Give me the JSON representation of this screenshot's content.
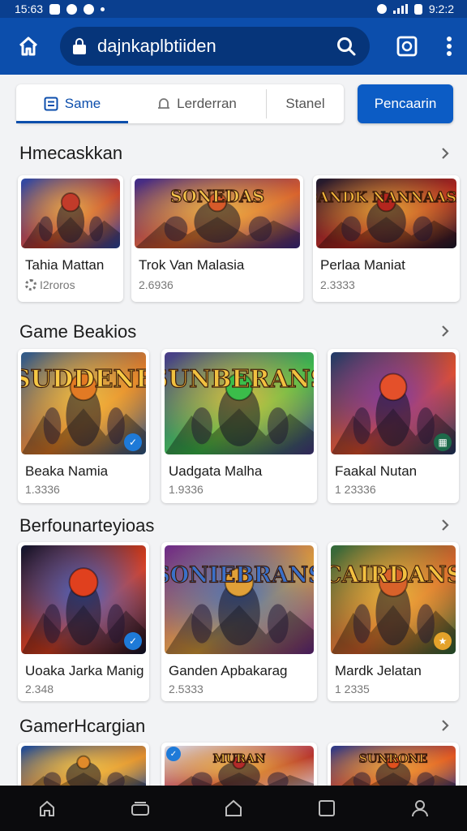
{
  "status_bar": {
    "time_left": "15:63",
    "time_right": "9:2:2"
  },
  "address_bar": {
    "url": "dajnkaplbtiiden"
  },
  "tabs": [
    {
      "label": "Same",
      "icon": "list-icon",
      "active": true
    },
    {
      "label": "Lerderran",
      "icon": "bell-icon",
      "active": false
    },
    {
      "label": "Stanel",
      "icon": "",
      "active": false
    }
  ],
  "primary_button": {
    "label": "Pencaarin"
  },
  "sections": [
    {
      "title": "Hmecaskkan",
      "games": [
        {
          "name": "Tahia Mattan",
          "meta": "I2roros",
          "art_title": "",
          "palette": [
            "#2a4aa8",
            "#c23b2a",
            "#f3b84a"
          ]
        },
        {
          "name": "Trok Van Malasia",
          "meta": "2.6936",
          "art_title": "SONEDAS",
          "palette": [
            "#3d2a8a",
            "#d65a2a",
            "#f2c14a"
          ]
        },
        {
          "name": "Perlaa Maniat",
          "meta": "2.3333",
          "art_title": "DANDK NANNAASA",
          "palette": [
            "#1c1a2e",
            "#b3261e",
            "#f0b43a"
          ]
        }
      ]
    },
    {
      "title": "Game Beakios",
      "games": [
        {
          "name": "Beaka Namia",
          "meta": "1.3336",
          "art_title": "SUDDENE",
          "palette": [
            "#2d5a8c",
            "#e27a24",
            "#f6c845"
          ]
        },
        {
          "name": "Uadgata Malha",
          "meta": "1.9336",
          "art_title": "SUNBERANS",
          "palette": [
            "#4a3a8a",
            "#3bbd4a",
            "#f0c040"
          ]
        },
        {
          "name": "Faakal Nutan",
          "meta": "1 23336",
          "art_title": "",
          "palette": [
            "#1e3a6a",
            "#e4502a",
            "#7a3ab0"
          ]
        }
      ]
    },
    {
      "title": "Berfounarteyioas",
      "games": [
        {
          "name": "Uoaka Jarka Manig",
          "meta": "2.348",
          "art_title": "",
          "palette": [
            "#0e1530",
            "#e0401e",
            "#3a6ad8"
          ]
        },
        {
          "name": "Ganden Apbakarag",
          "meta": "2.5333",
          "art_title": "SONIEBRANS",
          "palette": [
            "#6a2a8a",
            "#e0a038",
            "#3a70c8"
          ]
        },
        {
          "name": "Mardk Jelatan",
          "meta": "1 2335",
          "art_title": "CAIRDANS",
          "palette": [
            "#2f6a3a",
            "#d8622a",
            "#f2c040"
          ]
        }
      ]
    },
    {
      "title": "GamerHcargian",
      "games": [
        {
          "name": "",
          "meta": "",
          "art_title": "",
          "palette": [
            "#1a4a9a",
            "#e08a2a",
            "#f5c84a"
          ]
        },
        {
          "name": "",
          "meta": "",
          "art_title": "MURAN",
          "palette": [
            "#d8dde8",
            "#b32a2a",
            "#f2c040"
          ]
        },
        {
          "name": "",
          "meta": "",
          "art_title": "SUNRONE",
          "palette": [
            "#2a3a8a",
            "#e0501e",
            "#f2b040"
          ]
        }
      ]
    }
  ],
  "bottom_nav": [
    "home-icon",
    "tabs-icon",
    "home-outline-icon",
    "square-icon",
    "profile-icon"
  ],
  "colors": {
    "brand": "#0c4eac",
    "brand_dark": "#06357a",
    "button": "#0c5cc5",
    "background": "#f2f3f5"
  }
}
